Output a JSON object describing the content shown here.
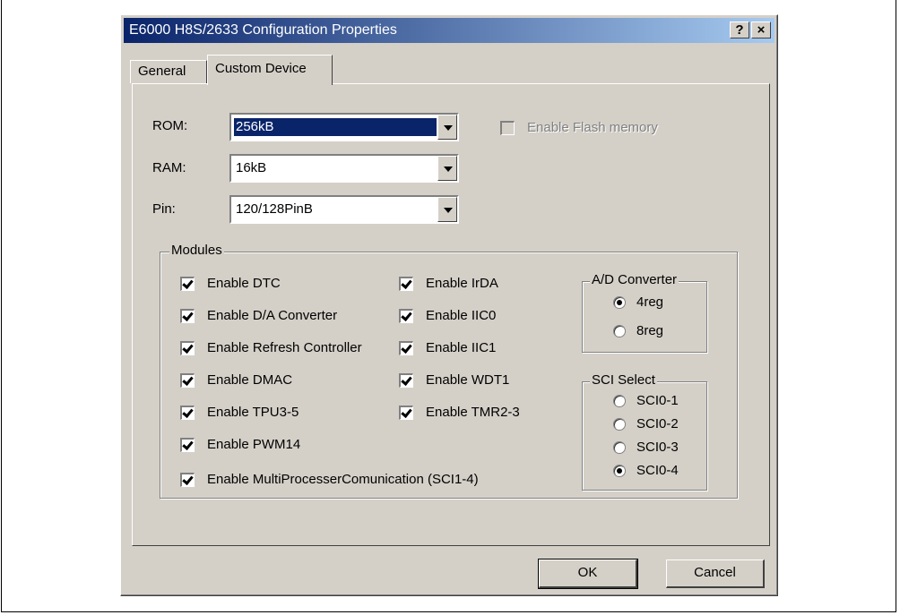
{
  "window": {
    "title": "E6000 H8S/2633 Configuration Properties",
    "help_button": "?",
    "close_button": "×"
  },
  "tabs": [
    {
      "label": "General"
    },
    {
      "label": "Custom Device"
    }
  ],
  "form": {
    "rom": {
      "label": "ROM:",
      "value": "256kB"
    },
    "ram": {
      "label": "RAM:",
      "value": "16kB"
    },
    "pin": {
      "label": "Pin:",
      "value": "120/128PinB"
    },
    "flash": {
      "label": "Enable Flash memory",
      "checked": false,
      "enabled": false
    }
  },
  "modules": {
    "title": "Modules",
    "left": [
      {
        "label": "Enable DTC",
        "checked": true
      },
      {
        "label": "Enable D/A Converter",
        "checked": true
      },
      {
        "label": "Enable Refresh Controller",
        "checked": true
      },
      {
        "label": "Enable DMAC",
        "checked": true
      },
      {
        "label": "Enable TPU3-5",
        "checked": true
      },
      {
        "label": "Enable PWM14",
        "checked": true
      },
      {
        "label": "Enable MultiProcesserComunication (SCI1-4)",
        "checked": true
      }
    ],
    "right": [
      {
        "label": "Enable IrDA",
        "checked": true
      },
      {
        "label": "Enable IIC0",
        "checked": true
      },
      {
        "label": "Enable IIC1",
        "checked": true
      },
      {
        "label": "Enable WDT1",
        "checked": true
      },
      {
        "label": "Enable TMR2-3",
        "checked": true
      }
    ],
    "ad_converter": {
      "title": "A/D Converter",
      "options": [
        {
          "label": "4reg",
          "selected": true
        },
        {
          "label": "8reg",
          "selected": false
        }
      ]
    },
    "sci_select": {
      "title": "SCI Select",
      "options": [
        {
          "label": "SCI0-1",
          "selected": false
        },
        {
          "label": "SCI0-2",
          "selected": false
        },
        {
          "label": "SCI0-3",
          "selected": false
        },
        {
          "label": "SCI0-4",
          "selected": true
        }
      ]
    }
  },
  "buttons": {
    "ok": "OK",
    "cancel": "Cancel"
  }
}
